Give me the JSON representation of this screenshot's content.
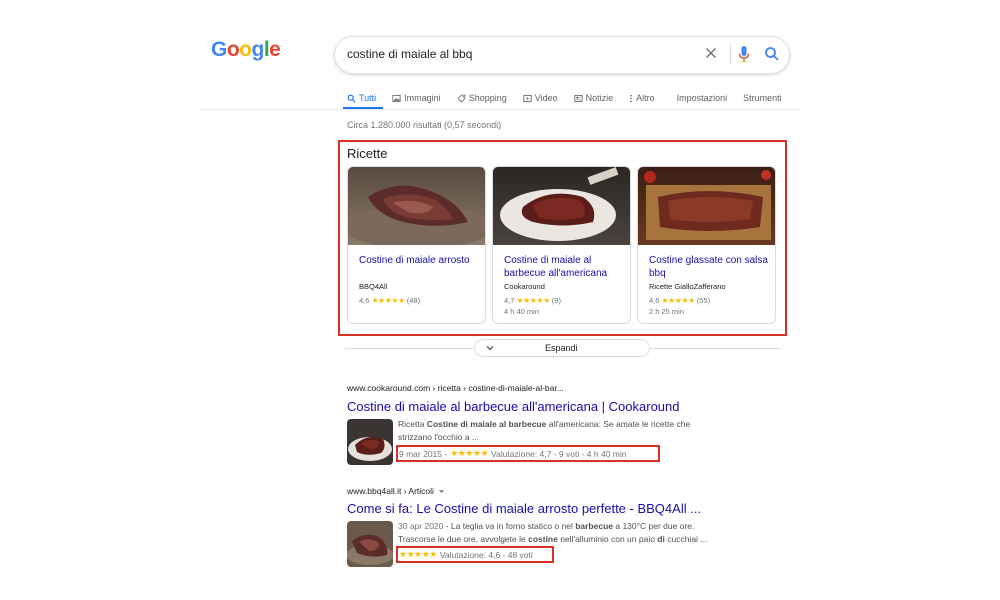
{
  "logo": {
    "text": "Google"
  },
  "search": {
    "query": "costine di maiale al bbq"
  },
  "tabs": [
    {
      "label": "Tutti",
      "icon": "search-icon",
      "active": true
    },
    {
      "label": "Immagini",
      "icon": "image-icon"
    },
    {
      "label": "Shopping",
      "icon": "tag-icon"
    },
    {
      "label": "Video",
      "icon": "video-icon"
    },
    {
      "label": "Notizie",
      "icon": "news-icon"
    },
    {
      "label": "Altro",
      "icon": "more-vert-icon"
    },
    {
      "label": "Impostazioni"
    },
    {
      "label": "Strumenti"
    }
  ],
  "stats": "Circa 1.280.000 risultati (0,57 secondi)",
  "recipes": {
    "title": "Ricette",
    "cards": [
      {
        "title": "Costine di maiale arrosto",
        "source": "BBQ4All",
        "rating": "4,6",
        "stars": "★★★★★",
        "votes": "(48)",
        "time": ""
      },
      {
        "title": "Costine di maiale al barbecue all'americana",
        "source": "Cookaround",
        "rating": "4,7",
        "stars": "★★★★★",
        "votes": "(9)",
        "time": "4 h 40 min"
      },
      {
        "title": "Costine glassate con salsa bbq",
        "source": "Ricette GialloZafferano",
        "rating": "4,6",
        "stars": "★★★★★",
        "votes": "(55)",
        "time": "2 h 25 min"
      }
    ],
    "expand_label": "Espandi"
  },
  "results": [
    {
      "url": "www.cookaround.com › ricetta › costine-di-maiale-al-bar...",
      "title": "Costine di maiale al barbecue all'americana | Cookaround",
      "snippet_pre": "Ricetta ",
      "snippet_bold": "Costine di maiale al barbecue",
      "snippet_post": " all'americana: Se amate le ricette che",
      "snippet_line2": "strizzano l'occhio a ...",
      "meta_date": "9 mar 2015 -",
      "meta_stars": "★★★★★",
      "meta_text": "Valutazione: 4,7 - 9 voti - 4 h 40 min"
    },
    {
      "url": "www.bbq4all.it › Articoli",
      "title": "Come si fa: Le Costine di maiale arrosto perfette - BBQ4All ...",
      "snippet_line1_a": "30 apr 2020",
      "snippet_line1_b": " - La teglia va in forno statico o nel ",
      "snippet_line1_bold": "barbecue",
      "snippet_line1_c": " a 130°C per due ore.",
      "snippet_line2_a": "Trascorse le due ore, avvolgete le ",
      "snippet_line2_bold": "costine",
      "snippet_line2_b": " nell'alluminio con un paio ",
      "snippet_line2_bold2": "di",
      "snippet_line2_c": " cucchiai ...",
      "meta_stars": "★★★★★",
      "meta_text": "Valutazione: 4,6 - 48 voti"
    }
  ],
  "colors": {
    "link": "#1a0dab",
    "accent": "#1a73e8",
    "highlight": "#d93025",
    "star": "#fbbc04"
  }
}
